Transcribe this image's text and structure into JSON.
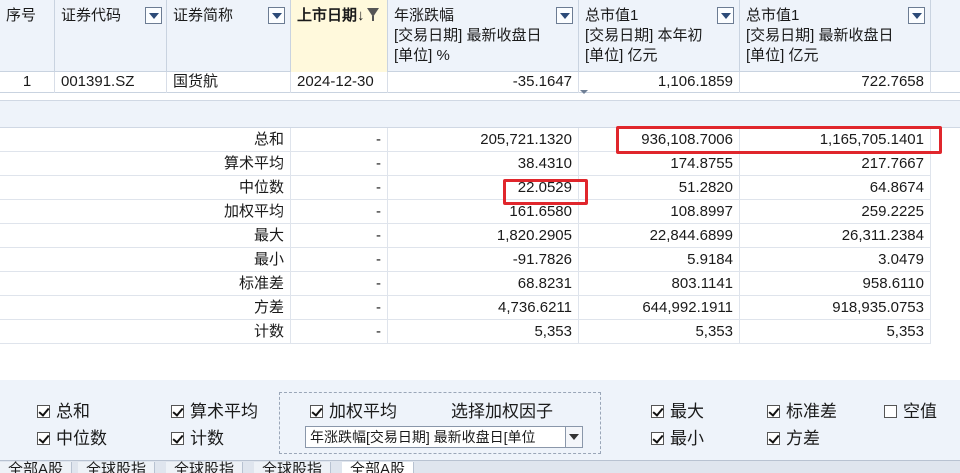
{
  "header": {
    "cols": [
      {
        "title": "序号"
      },
      {
        "title": "证券代码",
        "icon": "dropdown-icon"
      },
      {
        "title": "证券简称",
        "icon": "dropdown-icon"
      },
      {
        "title": "上市日期↓",
        "icon": "filter-icon"
      },
      {
        "title": "年涨跌幅",
        "sub1": "[交易日期] 最新收盘日",
        "sub2": "[单位] %",
        "icon": "dropdown-icon"
      },
      {
        "title": "总市值1",
        "sub1": "[交易日期] 本年初",
        "sub2": "[单位] 亿元",
        "icon": "dropdown-icon"
      },
      {
        "title": "总市值1",
        "sub1": "[交易日期] 最新收盘日",
        "sub2": "[单位] 亿元",
        "icon": "dropdown-icon"
      }
    ]
  },
  "row": {
    "index": "1",
    "code": "001391.SZ",
    "name": "国货航",
    "list_date": "2024-12-30",
    "change": "-35.1647",
    "mcap_start": "1,106.1859",
    "mcap_latest": "722.7658"
  },
  "stats": [
    {
      "label": "总和",
      "date": "-",
      "change": "205,721.1320",
      "mcap_start": "936,108.7006",
      "mcap_latest": "1,165,705.1401"
    },
    {
      "label": "算术平均",
      "date": "-",
      "change": "38.4310",
      "mcap_start": "174.8755",
      "mcap_latest": "217.7667"
    },
    {
      "label": "中位数",
      "date": "-",
      "change": "22.0529",
      "mcap_start": "51.2820",
      "mcap_latest": "64.8674"
    },
    {
      "label": "加权平均",
      "date": "-",
      "change": "161.6580",
      "mcap_start": "108.8997",
      "mcap_latest": "259.2225"
    },
    {
      "label": "最大",
      "date": "-",
      "change": "1,820.2905",
      "mcap_start": "22,844.6899",
      "mcap_latest": "26,311.2384"
    },
    {
      "label": "最小",
      "date": "-",
      "change": "-91.7826",
      "mcap_start": "5.9184",
      "mcap_latest": "3.0479"
    },
    {
      "label": "标准差",
      "date": "-",
      "change": "68.8231",
      "mcap_start": "803.1141",
      "mcap_latest": "958.6110"
    },
    {
      "label": "方差",
      "date": "-",
      "change": "4,736.6211",
      "mcap_start": "644,992.1911",
      "mcap_latest": "918,935.0753"
    },
    {
      "label": "计数",
      "date": "-",
      "change": "5,353",
      "mcap_start": "5,353",
      "mcap_latest": "5,353"
    }
  ],
  "highlight_color": "#e0262c",
  "options": {
    "sum": {
      "label": "总和",
      "checked": true
    },
    "median": {
      "label": "中位数",
      "checked": true
    },
    "mean": {
      "label": "算术平均",
      "checked": true
    },
    "count": {
      "label": "计数",
      "checked": true
    },
    "weighted": {
      "label": "加权平均",
      "checked": true
    },
    "weight_factor_label": "选择加权因子",
    "weight_factor_value": "年涨跌幅[交易日期] 最新收盘日[单位",
    "max": {
      "label": "最大",
      "checked": true
    },
    "min": {
      "label": "最小",
      "checked": true
    },
    "std": {
      "label": "标准差",
      "checked": true
    },
    "var": {
      "label": "方差",
      "checked": true
    },
    "blank": {
      "label": "空值",
      "checked": false
    }
  },
  "tabs": [
    "全部A股",
    "全球股指",
    "全球股指",
    "全球股指",
    "全部A股"
  ]
}
